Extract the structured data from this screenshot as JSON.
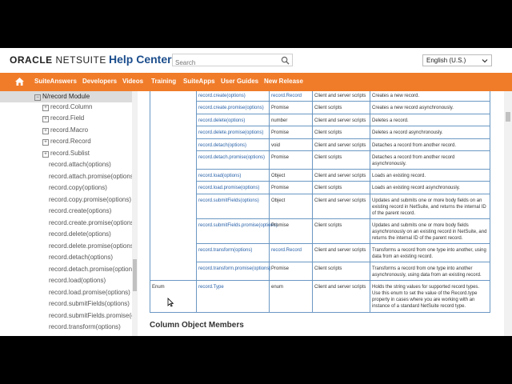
{
  "header": {
    "logo_a": "ORACLE",
    "logo_b": "NETSUITE",
    "title": "Help Center",
    "search_placeholder": "Search",
    "language": "English (U.S.)"
  },
  "nav": {
    "items": [
      "SuiteAnswers",
      "Developers",
      "Videos",
      "Training",
      "SuiteApps",
      "User Guides",
      "New Release"
    ]
  },
  "sidebar": {
    "module": "N/record Module",
    "objects": [
      "record.Column",
      "record.Field",
      "record.Macro",
      "record.Record",
      "record.Sublist"
    ],
    "methods": [
      "record.attach(options)",
      "record.attach.promise(options)",
      "record.copy(options)",
      "record.copy.promise(options)",
      "record.create(options)",
      "record.create.promise(options)",
      "record.delete(options)",
      "record.delete.promise(options)",
      "record.detach(options)",
      "record.detach.promise(options)",
      "record.load(options)",
      "record.load.promise(options)",
      "record.submitFields(options)",
      "record.submitFields.promise(options)",
      "record.transform(options)"
    ]
  },
  "table": {
    "rows": [
      {
        "name": "record.create(options)",
        "ret": "record.Record",
        "ret_link": true,
        "scope": "Client and server scripts",
        "desc": "Creates a new record."
      },
      {
        "name": "record.create.promise(options)",
        "ret": "Promise",
        "ret_link": false,
        "scope": "Client scripts",
        "desc": "Creates a new record asynchronously."
      },
      {
        "name": "record.delete(options)",
        "ret": "number",
        "ret_link": false,
        "scope": "Client and server scripts",
        "desc": "Deletes a record."
      },
      {
        "name": "record.delete.promise(options)",
        "ret": "Promise",
        "ret_link": false,
        "scope": "Client scripts",
        "desc": "Deletes a record asynchronously."
      },
      {
        "name": "record.detach(options)",
        "ret": "void",
        "ret_link": false,
        "scope": "Client and server scripts",
        "desc": "Detaches a record from another record."
      },
      {
        "name": "record.detach.promise(options)",
        "ret": "Promise",
        "ret_link": false,
        "scope": "Client scripts",
        "desc": "Detaches a record from another record asynchronously."
      },
      {
        "name": "record.load(options)",
        "ret": "Object",
        "ret_link": false,
        "scope": "Client and server scripts",
        "desc": "Loads an existing record."
      },
      {
        "name": "record.load.promise(options)",
        "ret": "Promise",
        "ret_link": false,
        "scope": "Client scripts",
        "desc": "Loads an existing record asynchronously."
      },
      {
        "name": "record.submitFields(options)",
        "ret": "Object",
        "ret_link": false,
        "scope": "Client and server scripts",
        "desc": "Updates and submits one or more body fields on an existing record in NetSuite, and returns the internal ID of the parent record."
      },
      {
        "name": "record.submitFields.promise(options)",
        "ret": "Promise",
        "ret_link": false,
        "scope": "Client scripts",
        "desc": "Updates and submits one or more body fields asynchronously on an existing record in NetSuite, and returns the internal ID of the parent record."
      },
      {
        "name": "record.transform(options)",
        "ret": "record.Record",
        "ret_link": true,
        "scope": "Client and server scripts",
        "desc": "Transforms a record from one type into another, using data from an existing record."
      },
      {
        "name": "record.transform.promise(options)",
        "ret": "Promise",
        "ret_link": false,
        "scope": "Client scripts",
        "desc": "Transforms a record from one type into another asynchronously, using data from an existing record."
      }
    ],
    "enum_row": {
      "member_type": "Enum",
      "name": "record.Type",
      "ret": "enum",
      "scope": "Client and server scripts",
      "desc": "Holds the string values for supported record types. Use this enum to set the value of the Record.type property in cases where you are working with an instance of a standard NetSuite record type."
    }
  },
  "next_heading": "Column Object Members",
  "colors": {
    "nav": "#f07c2a",
    "title": "#1b4d8c",
    "link": "#2a62a8",
    "table_border": "#6a97c3"
  }
}
